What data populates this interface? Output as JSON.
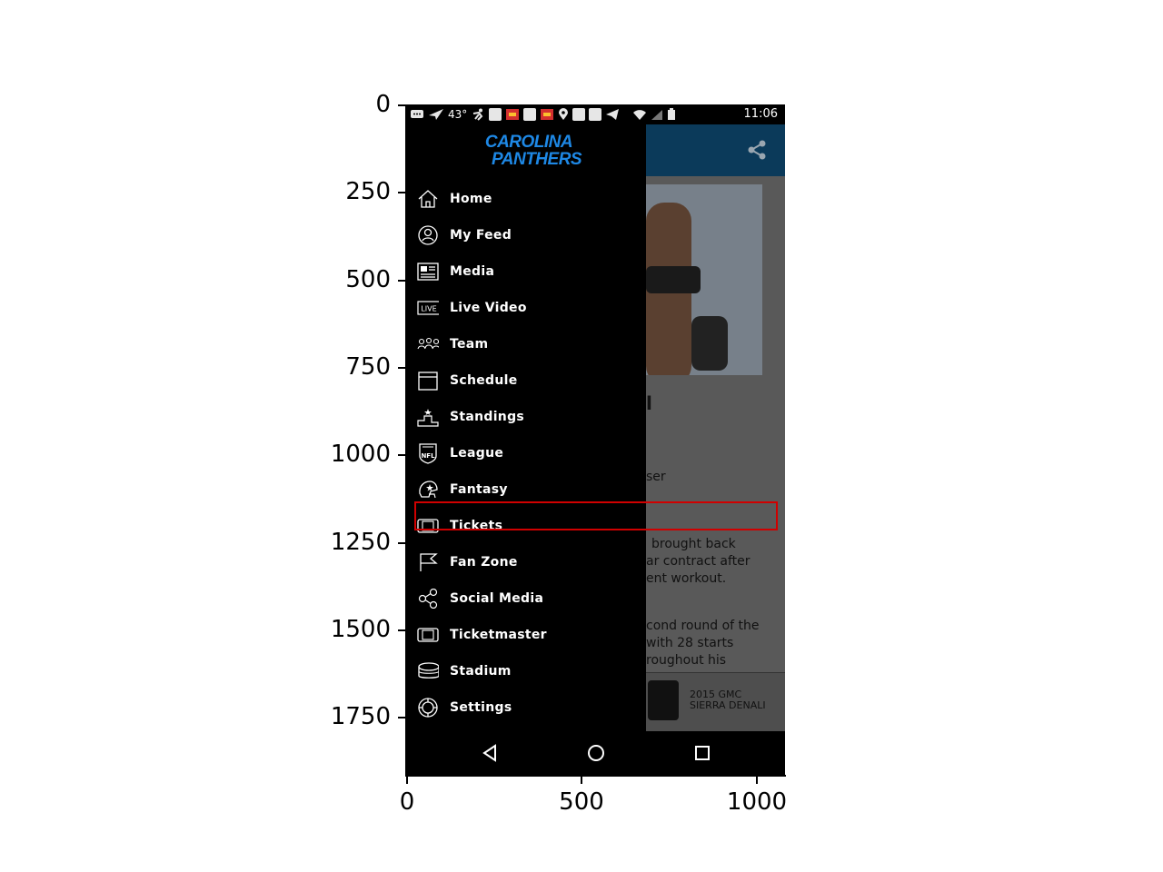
{
  "axes": {
    "y_ticks": [
      "0",
      "250",
      "500",
      "750",
      "1000",
      "1250",
      "1500",
      "1750"
    ],
    "x_ticks": [
      "0",
      "500",
      "1000"
    ]
  },
  "statusbar": {
    "temperature": "43°",
    "time": "11:06"
  },
  "drawer": {
    "logo_line1": "CAROLINA",
    "logo_line2": "PANTHERS",
    "items": [
      {
        "label": "Home",
        "icon": "home-icon"
      },
      {
        "label": "My Feed",
        "icon": "user-circle-icon"
      },
      {
        "label": "Media",
        "icon": "newspaper-icon"
      },
      {
        "label": "Live Video",
        "icon": "live-icon"
      },
      {
        "label": "Team",
        "icon": "group-icon"
      },
      {
        "label": "Schedule",
        "icon": "calendar-icon"
      },
      {
        "label": "Standings",
        "icon": "podium-icon"
      },
      {
        "label": "League",
        "icon": "nfl-shield-icon"
      },
      {
        "label": "Fantasy",
        "icon": "helmet-icon"
      },
      {
        "label": "Tickets",
        "icon": "ticket-icon"
      },
      {
        "label": "Fan Zone",
        "icon": "flag-icon"
      },
      {
        "label": "Social Media",
        "icon": "share-nodes-icon"
      },
      {
        "label": "Ticketmaster",
        "icon": "ticket-icon"
      },
      {
        "label": "Stadium",
        "icon": "stadium-icon"
      },
      {
        "label": "Settings",
        "icon": "gear-icon"
      }
    ]
  },
  "background": {
    "headline_fragment": "l",
    "byline_fragment": "ser",
    "body_lines_1": [
      "brought back",
      "ar contract after",
      "ent workout."
    ],
    "body_lines_2": [
      "cond round of the",
      "with 28 starts",
      "roughout his"
    ],
    "ad_text": "2015 GMC\nSIERRA DENALI"
  },
  "colors": {
    "logo_blue": "#1e88e5",
    "highlight_red": "#d00000",
    "header_blue": "#0b3a5a"
  }
}
